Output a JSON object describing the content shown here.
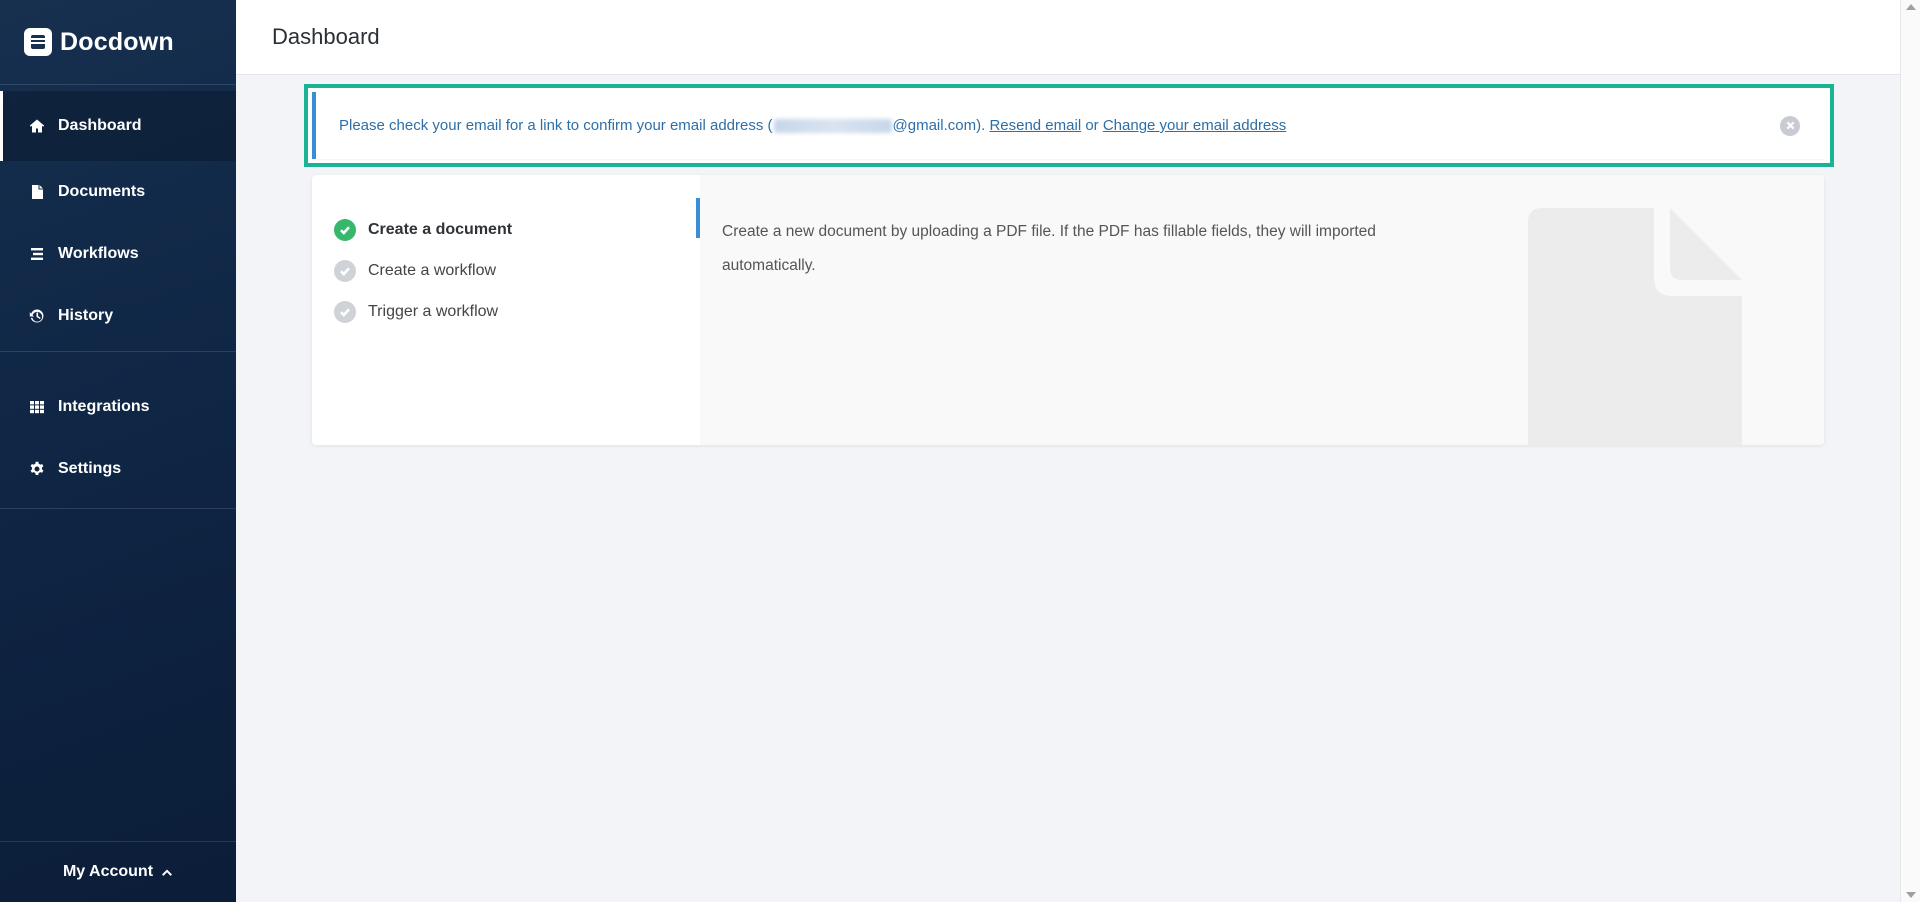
{
  "app": {
    "name": "Docdown"
  },
  "sidebar": {
    "items": [
      {
        "label": "Dashboard",
        "icon": "home-icon",
        "active": true
      },
      {
        "label": "Documents",
        "icon": "file-icon"
      },
      {
        "label": "Workflows",
        "icon": "list-icon"
      },
      {
        "label": "History",
        "icon": "history-icon"
      },
      {
        "label": "Integrations",
        "icon": "grid-icon"
      },
      {
        "label": "Settings",
        "icon": "gear-icon"
      }
    ],
    "account_label": "My Account"
  },
  "header": {
    "title": "Dashboard"
  },
  "notice": {
    "text_before": "Please check your email for a link to confirm your email address (",
    "email_domain": "@gmail.com).",
    "resend_label": "Resend email",
    "or_text": "or",
    "change_label": "Change your email address",
    "accent_color": "#1ab394"
  },
  "onboarding": {
    "steps": [
      {
        "label": "Create a document",
        "done": true
      },
      {
        "label": "Create a workflow",
        "done": false
      },
      {
        "label": "Trigger a workflow",
        "done": false
      }
    ],
    "description": "Create a new document by uploading a PDF file. If the PDF has fillable fields, they will imported automatically."
  }
}
